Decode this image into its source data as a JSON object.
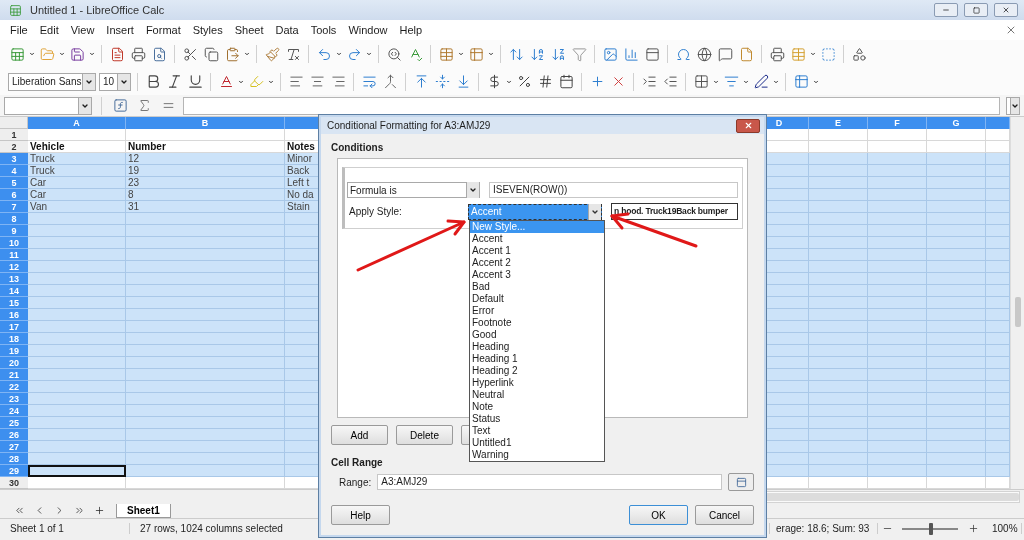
{
  "window": {
    "title": "Untitled 1 - LibreOffice Calc"
  },
  "menu": [
    "File",
    "Edit",
    "View",
    "Insert",
    "Format",
    "Styles",
    "Sheet",
    "Data",
    "Tools",
    "Window",
    "Help"
  ],
  "formatting": {
    "font": "Liberation Sans",
    "size": "10"
  },
  "sheet": {
    "columns": [
      {
        "label": "A",
        "selected": true
      },
      {
        "label": "B",
        "selected": true
      },
      {
        "selected": true
      },
      {
        "label": "D",
        "selected": true
      },
      {
        "label": "E",
        "selected": true
      },
      {
        "label": "F",
        "selected": true
      },
      {
        "label": "G",
        "selected": true
      },
      {
        "selected": true
      }
    ],
    "rows": [
      {
        "number": "1",
        "selected": false,
        "cursor": false
      },
      {
        "number": "2",
        "selected": false,
        "cursor": false,
        "bold": true,
        "cells": [
          "Vehicle",
          "Number",
          "Notes"
        ]
      },
      {
        "number": "3",
        "selected": true,
        "cursor": false,
        "cells": [
          "Truck",
          "12",
          "Minor"
        ]
      },
      {
        "number": "4",
        "selected": true,
        "cursor": false,
        "cells": [
          "Truck",
          "19",
          "Back"
        ]
      },
      {
        "number": "5",
        "selected": true,
        "cursor": false,
        "cells": [
          "Car",
          "23",
          "Left t"
        ]
      },
      {
        "number": "6",
        "selected": true,
        "cursor": false,
        "cells": [
          "Car",
          "8",
          "No da"
        ]
      },
      {
        "number": "7",
        "selected": true,
        "cursor": false,
        "cells": [
          "Van",
          "31",
          "Stain"
        ]
      },
      {
        "number": "8",
        "selected": true,
        "cursor": false
      },
      {
        "number": "9",
        "selected": true,
        "cursor": false
      },
      {
        "number": "10",
        "selected": true,
        "cursor": false
      },
      {
        "number": "11",
        "selected": true,
        "cursor": false
      },
      {
        "number": "12",
        "selected": true,
        "cursor": false
      },
      {
        "number": "13",
        "selected": true,
        "cursor": false
      },
      {
        "number": "14",
        "selected": true,
        "cursor": false
      },
      {
        "number": "15",
        "selected": true,
        "cursor": false
      },
      {
        "number": "16",
        "selected": true,
        "cursor": false
      },
      {
        "number": "17",
        "selected": true,
        "cursor": false
      },
      {
        "number": "18",
        "selected": true,
        "cursor": false
      },
      {
        "number": "19",
        "selected": true,
        "cursor": false
      },
      {
        "number": "20",
        "selected": true,
        "cursor": false
      },
      {
        "number": "21",
        "selected": true,
        "cursor": false
      },
      {
        "number": "22",
        "selected": true,
        "cursor": false
      },
      {
        "number": "23",
        "selected": true,
        "cursor": false
      },
      {
        "number": "24",
        "selected": true,
        "cursor": false
      },
      {
        "number": "25",
        "selected": true,
        "cursor": false
      },
      {
        "number": "26",
        "selected": true,
        "cursor": false
      },
      {
        "number": "27",
        "selected": true,
        "cursor": false
      },
      {
        "number": "28",
        "selected": true,
        "cursor": false
      },
      {
        "number": "29",
        "selected": true,
        "cursor": true
      },
      {
        "number": "30",
        "selected": false,
        "cursor": false
      }
    ]
  },
  "sheet_tabs": [
    {
      "label": "Sheet1",
      "selected": true
    }
  ],
  "status_bar": {
    "sheet": "Sheet 1 of 1",
    "selection": "27 rows, 1024 columns selected",
    "summary": "erage: 18.6; Sum: 93",
    "zoom": {
      "level": 0.52
    },
    "zoom_reading": "100%"
  },
  "dialog": {
    "title": "Conditional Formatting for A3:AMJ29",
    "conditions_heading": "Conditions",
    "condition": {
      "type": "Formula is",
      "formula": "ISEVEN(ROW())",
      "style_label": "Apply Style:",
      "style": "Accent",
      "preview": "n hood. Truck19Back bumper"
    },
    "style_list": [
      {
        "label": "New Style...",
        "selected": true
      },
      {
        "label": "Accent",
        "selected": false
      },
      {
        "label": "Accent 1",
        "selected": false
      },
      {
        "label": "Accent 2",
        "selected": false
      },
      {
        "label": "Accent 3",
        "selected": false
      },
      {
        "label": "Bad",
        "selected": false
      },
      {
        "label": "Default",
        "selected": false
      },
      {
        "label": "Error",
        "selected": false
      },
      {
        "label": "Footnote",
        "selected": false
      },
      {
        "label": "Good",
        "selected": false
      },
      {
        "label": "Heading",
        "selected": false
      },
      {
        "label": "Heading 1",
        "selected": false
      },
      {
        "label": "Heading 2",
        "selected": false
      },
      {
        "label": "Hyperlink",
        "selected": false
      },
      {
        "label": "Neutral",
        "selected": false
      },
      {
        "label": "Note",
        "selected": false
      },
      {
        "label": "Status",
        "selected": false
      },
      {
        "label": "Text",
        "selected": false
      },
      {
        "label": "Untitled1",
        "selected": false
      },
      {
        "label": "Warning",
        "selected": false
      }
    ],
    "buttons": [
      "Add",
      "Delete"
    ],
    "range_heading": "Cell Range",
    "range_label": "Range:",
    "range": "A3:AMJ29",
    "footer_buttons": [
      {
        "label": "Help",
        "default": false
      },
      {
        "label": "OK",
        "default": true
      },
      {
        "label": "Cancel",
        "default": false
      }
    ]
  }
}
